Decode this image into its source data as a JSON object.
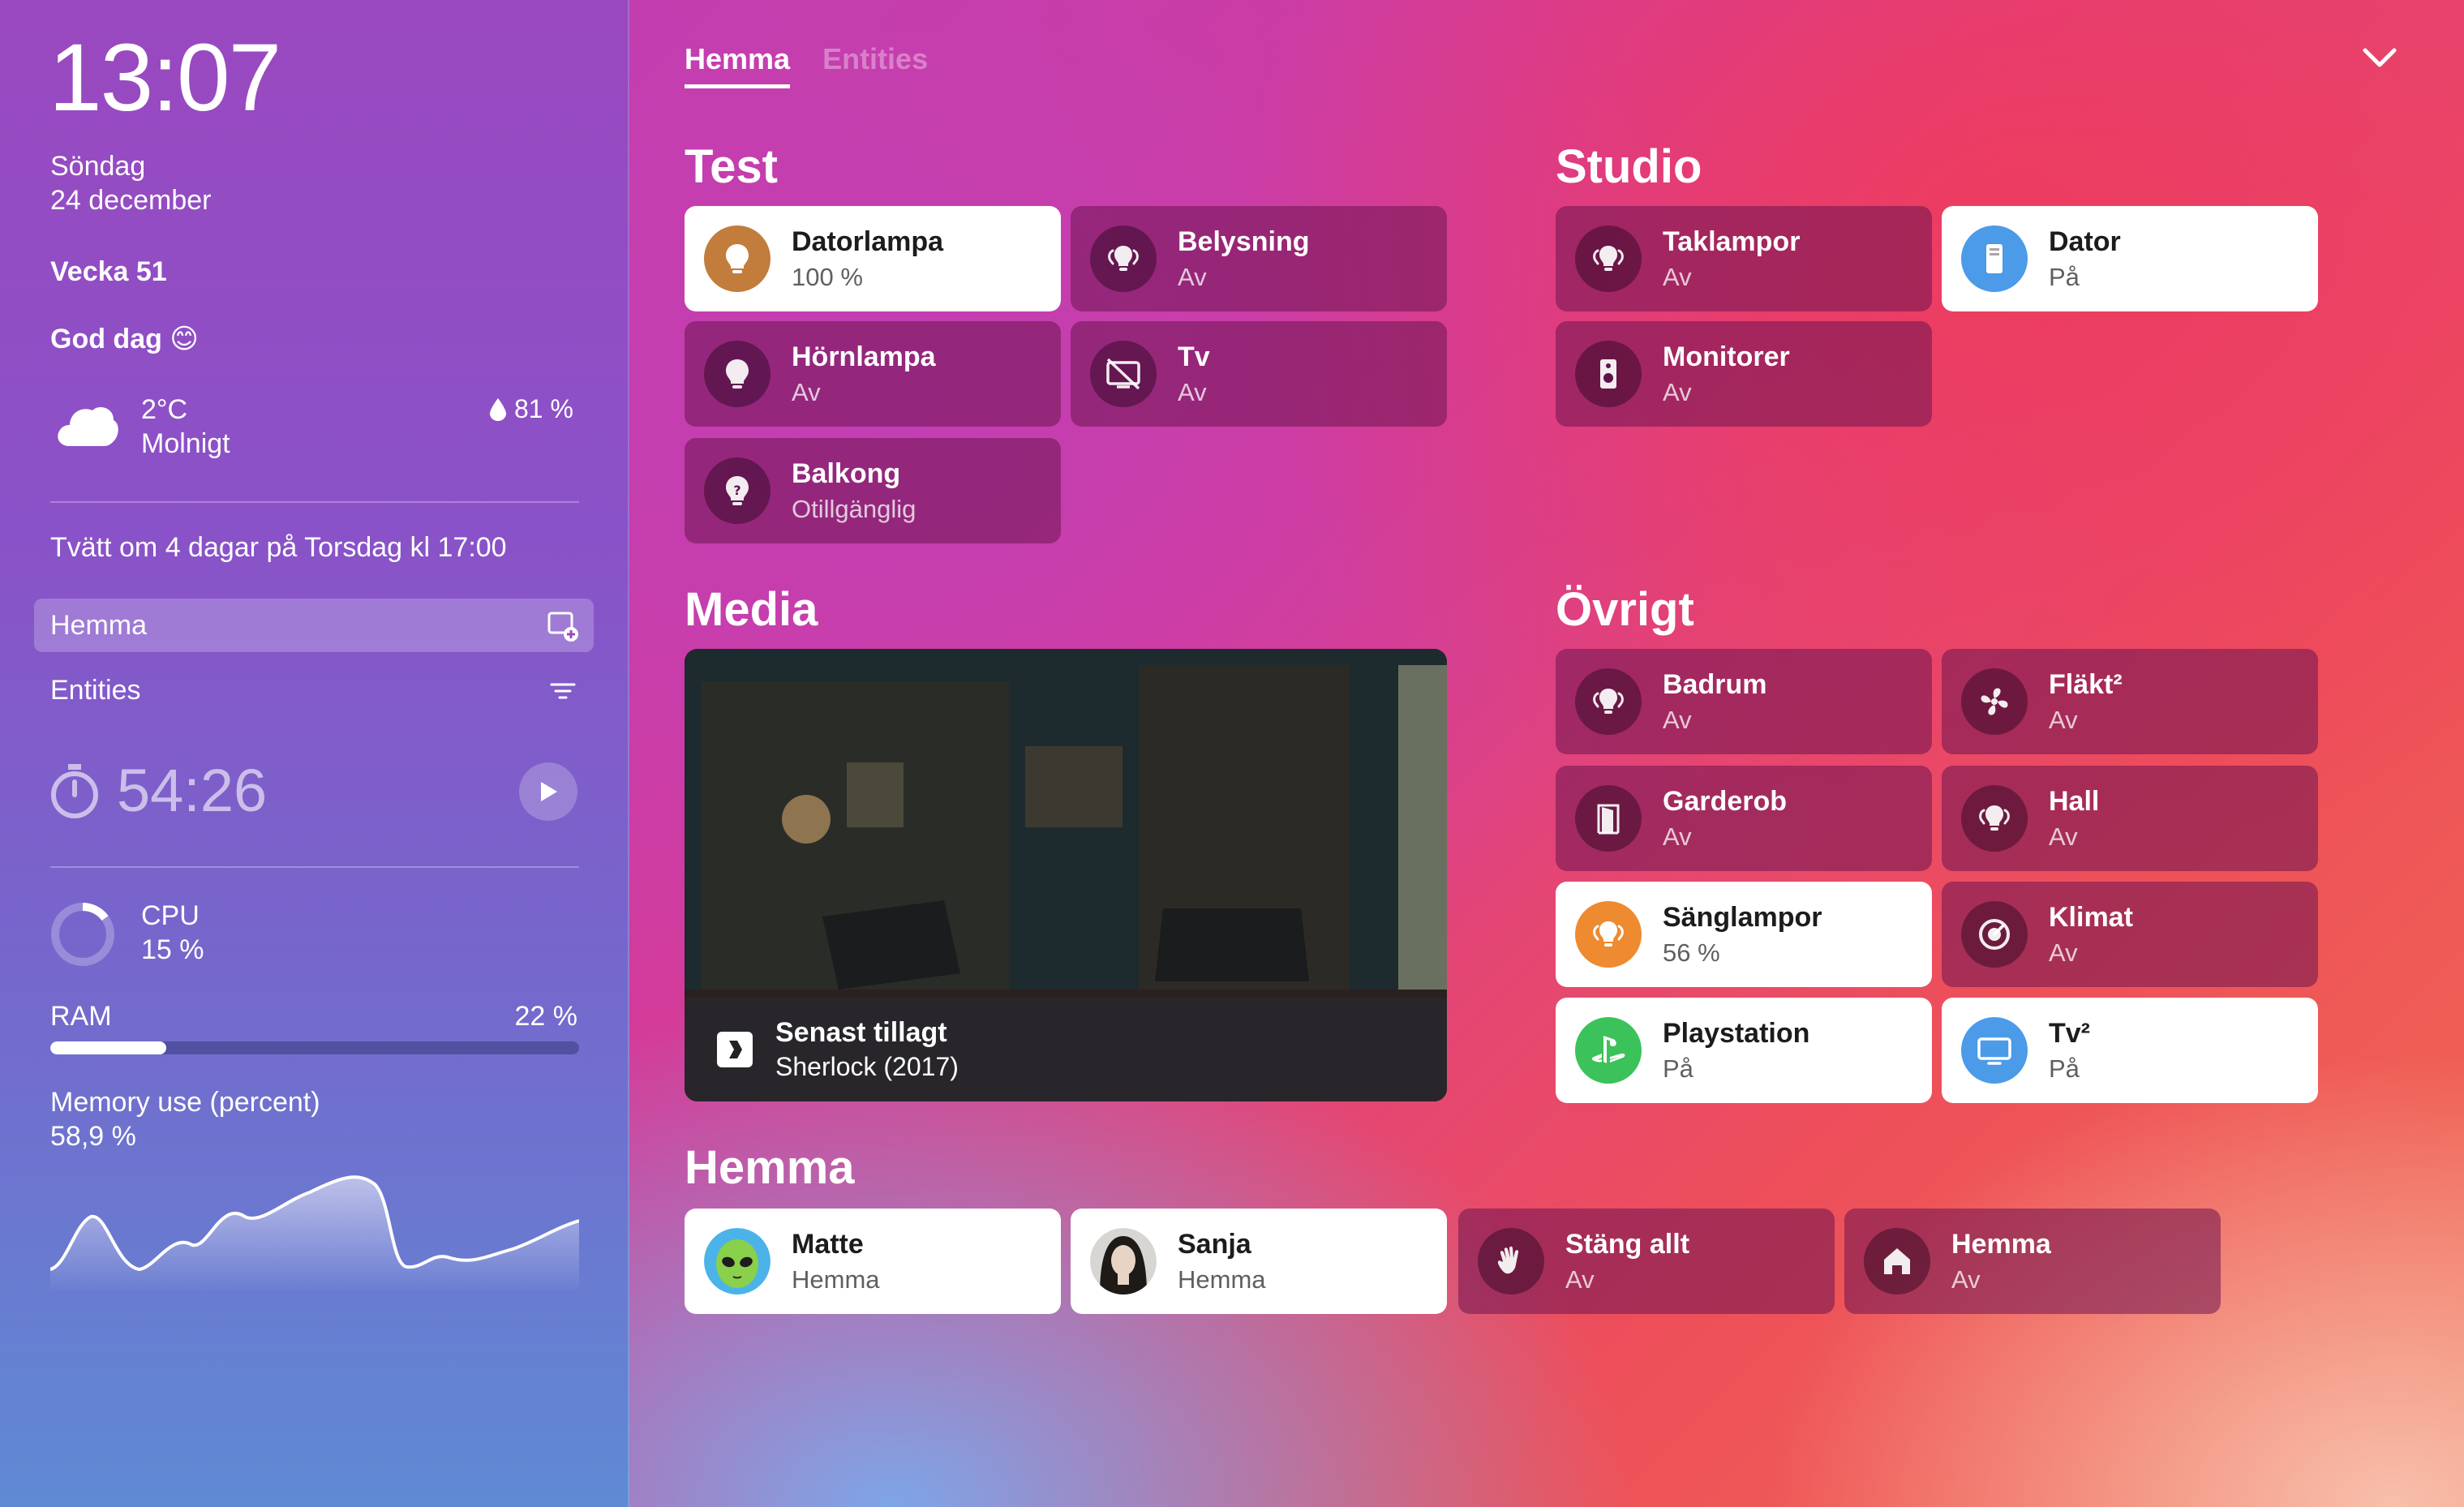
{
  "sidebar": {
    "time": "13:07",
    "day": "Söndag",
    "date": "24 december",
    "week": "Vecka 51",
    "greeting": "God dag 😊",
    "weather": {
      "temp": "2°C",
      "condition": "Molnigt",
      "humidity": "81 %",
      "icon": "cloud-icon"
    },
    "reminder": "Tvätt om 4 dagar på Torsdag kl 17:00",
    "nav": [
      {
        "label": "Hemma",
        "active": true,
        "icon": "dashboard-add-icon"
      },
      {
        "label": "Entities",
        "active": false,
        "icon": "filter-icon"
      }
    ],
    "timer": "54:26",
    "cpu": {
      "label": "CPU",
      "value": "15 %",
      "fraction": 0.15
    },
    "ram": {
      "label": "RAM",
      "value": "22 %",
      "fraction": 0.22
    },
    "memory": {
      "label": "Memory use (percent)",
      "value": "58,9 %"
    }
  },
  "tabs": [
    {
      "label": "Hemma",
      "active": true
    },
    {
      "label": "Entities",
      "active": false
    }
  ],
  "sections": {
    "test": {
      "title": "Test",
      "cards": [
        {
          "name": "Datorlampa",
          "state": "100 %",
          "on": true,
          "icon": "bulb-icon",
          "color": "#c27c3c"
        },
        {
          "name": "Belysning",
          "state": "Av",
          "on": false,
          "icon": "lightbulb-group-icon"
        },
        {
          "name": "Hörnlampa",
          "state": "Av",
          "on": false,
          "icon": "bulb-icon"
        },
        {
          "name": "Tv",
          "state": "Av",
          "on": false,
          "icon": "tv-off-icon"
        },
        {
          "name": "Balkong",
          "state": "Otillgänglig",
          "on": false,
          "icon": "bulb-unavailable-icon"
        }
      ]
    },
    "studio": {
      "title": "Studio",
      "cards": [
        {
          "name": "Taklampor",
          "state": "Av",
          "on": false,
          "icon": "lightbulb-group-icon"
        },
        {
          "name": "Dator",
          "state": "På",
          "on": true,
          "icon": "desktop-tower-icon",
          "color": "#4b9be8"
        },
        {
          "name": "Monitorer",
          "state": "Av",
          "on": false,
          "icon": "speaker-icon"
        }
      ]
    },
    "media": {
      "title": "Media",
      "label": "Senast tillagt",
      "subtitle": "Sherlock (2017)",
      "icon": "plex-icon"
    },
    "ovrigt": {
      "title": "Övrigt",
      "cards": [
        {
          "name": "Badrum",
          "state": "Av",
          "on": false,
          "icon": "lightbulb-group-icon"
        },
        {
          "name": "Fläkt²",
          "state": "Av",
          "on": false,
          "icon": "fan-icon"
        },
        {
          "name": "Garderob",
          "state": "Av",
          "on": false,
          "icon": "wardrobe-icon"
        },
        {
          "name": "Hall",
          "state": "Av",
          "on": false,
          "icon": "lightbulb-group-icon"
        },
        {
          "name": "Sänglampor",
          "state": "56 %",
          "on": true,
          "icon": "lightbulb-group-icon",
          "color": "#ee8a30"
        },
        {
          "name": "Klimat",
          "state": "Av",
          "on": false,
          "icon": "thermostat-icon"
        },
        {
          "name": "Playstation",
          "state": "På",
          "on": true,
          "icon": "playstation-icon",
          "color": "#3cc25a"
        },
        {
          "name": "Tv²",
          "state": "På",
          "on": true,
          "icon": "monitor-icon",
          "color": "#4b9be8"
        }
      ]
    },
    "hemma": {
      "title": "Hemma",
      "cards": [
        {
          "name": "Matte",
          "state": "Hemma",
          "on": true,
          "icon": "alien-avatar"
        },
        {
          "name": "Sanja",
          "state": "Hemma",
          "on": true,
          "icon": "person-avatar"
        },
        {
          "name": "Stäng allt",
          "state": "Av",
          "on": false,
          "icon": "hand-wave-icon"
        },
        {
          "name": "Hemma",
          "state": "Av",
          "on": false,
          "icon": "home-icon"
        }
      ]
    }
  },
  "colors": {
    "on_card": "#ffffff",
    "off_card": "rgba(110,20,80,0.55)"
  }
}
